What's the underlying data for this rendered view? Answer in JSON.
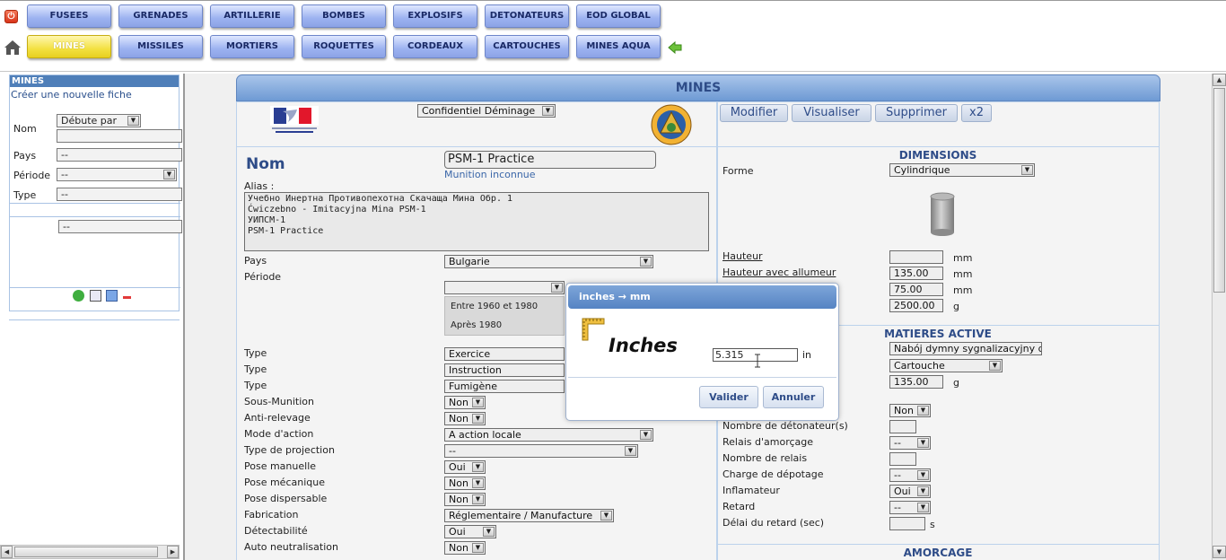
{
  "topnav": {
    "row1": [
      "FUSEES",
      "GRENADES",
      "ARTILLERIE",
      "BOMBES",
      "EXPLOSIFS",
      "DETONATEURS",
      "EOD GLOBAL"
    ],
    "row2": [
      "MINES",
      "MISSILES",
      "MORTIERS",
      "ROQUETTES",
      "CORDEAUX",
      "CARTOUCHES",
      "MINES AQUA"
    ],
    "active": "MINES"
  },
  "left": {
    "title": "MINES",
    "create_link": "Créer une nouvelle fiche",
    "nom_label": "Nom",
    "nom_mode": "Débute par",
    "pays_label": "Pays",
    "pays_value": "--",
    "periode_label": "Période",
    "periode_value": "--",
    "type_label": "Type",
    "type_value": "--",
    "extra_value": "--"
  },
  "main": {
    "banner": "MINES",
    "confidential": "Confidentiel Déminage",
    "tabs": [
      "Modifier",
      "Visualiser",
      "Supprimer",
      "x2"
    ],
    "nom_label": "Nom",
    "nom_value": "PSM-1 Practice",
    "munition_link": "Munition inconnue",
    "alias_label": "Alias :",
    "alias_text": "Учебно Инертна Противопехотна Скачаща Мина Обр. 1\nĆwiczebno - Imitacyjna Mina PSM-1\nУИПСМ-1\nPSM-1 Practice",
    "pays_label": "Pays",
    "pays_value": "Bulgarie",
    "periode_label": "Période",
    "periode_options": [
      "Entre 1960 et 1980",
      "Après 1980"
    ],
    "left_fields": [
      {
        "label": "Type",
        "value": "Exercice"
      },
      {
        "label": "Type",
        "value": "Instruction"
      },
      {
        "label": "Type",
        "value": "Fumigène"
      },
      {
        "label": "Sous-Munition",
        "value": "Non"
      },
      {
        "label": "Anti-relevage",
        "value": "Non"
      },
      {
        "label": "Mode d'action",
        "value": "A action locale"
      },
      {
        "label": "Type de projection",
        "value": "--"
      },
      {
        "label": "Pose manuelle",
        "value": "Oui"
      },
      {
        "label": "Pose mécanique",
        "value": "Non"
      },
      {
        "label": "Pose dispersable",
        "value": "Non"
      },
      {
        "label": "Fabrication",
        "value": "Réglementaire / Manufacture"
      },
      {
        "label": "Détectabilité",
        "value": "Oui"
      },
      {
        "label": "Auto neutralisation",
        "value": "Non"
      }
    ],
    "dimensions_title": "DIMENSIONS",
    "forme_label": "Forme",
    "forme_value": "Cylindrique",
    "hauteur_label": "Hauteur",
    "hauteur_value": "",
    "hauteur_allumeur_label": "Hauteur avec allumeur",
    "hauteur_allumeur_value": "135.00",
    "diam_value": "75.00",
    "masse_value": "2500.00",
    "unit_mm": "mm",
    "unit_g": "g",
    "matieres_title": "MATIERES ACTIVE",
    "matiere_value": "Nabój dymny sygnalizacyjny d",
    "matiere_type": "Cartouche",
    "matiere_masse": "135.00",
    "right_fields": [
      {
        "label": "",
        "value": "Non"
      },
      {
        "label": "Nombre de détonateur(s)",
        "value": ""
      },
      {
        "label": "Relais d'amorçage",
        "value": "--"
      },
      {
        "label": "Nombre de relais",
        "value": ""
      },
      {
        "label": "Charge de dépotage",
        "value": "--"
      },
      {
        "label": "Inflamateur",
        "value": "Oui"
      },
      {
        "label": "Retard",
        "value": "--"
      },
      {
        "label": "Délai du retard (sec)",
        "value": ""
      }
    ],
    "unit_s": "s",
    "amorcage_title": "AMORCAGE"
  },
  "modal": {
    "title": "inches → mm",
    "label": "Inches",
    "value": "5.315",
    "unit": "in",
    "ok": "Valider",
    "cancel": "Annuler"
  }
}
